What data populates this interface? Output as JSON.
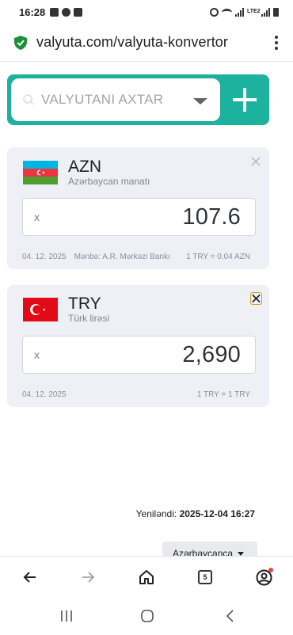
{
  "status_bar": {
    "time": "16:28",
    "network_label": "LTE2"
  },
  "browser": {
    "url": "valyuta.com/valyuta-konvertor"
  },
  "search": {
    "placeholder": "VALYUTANI AXTAR"
  },
  "currencies": [
    {
      "code": "AZN",
      "name": "Azərbaycan manatı",
      "prefix": "x",
      "amount": "107.6",
      "date": "04. 12. 2025",
      "source": "Mənbə: A.R. Mərkəzi Bankı",
      "rate": "1 TRY = 0.04 AZN"
    },
    {
      "code": "TRY",
      "name": "Türk lirəsi",
      "prefix": "x",
      "amount": "2,690",
      "date": "04. 12. 2025",
      "rate": "1 TRY = 1 TRY"
    }
  ],
  "updated": {
    "label": "Yeniləndi:",
    "value": "2025-12-04 16:27"
  },
  "language": {
    "selected": "Azərbaycanca"
  },
  "toolbar": {
    "tab_count": "5"
  },
  "colors": {
    "accent": "#1cb29e",
    "card_background": "#eef0f6",
    "azerbaijan_blue": "#00b5e2",
    "azerbaijan_red": "#ef3340",
    "azerbaijan_green": "#509e2f",
    "turkey_red": "#e30a17"
  }
}
